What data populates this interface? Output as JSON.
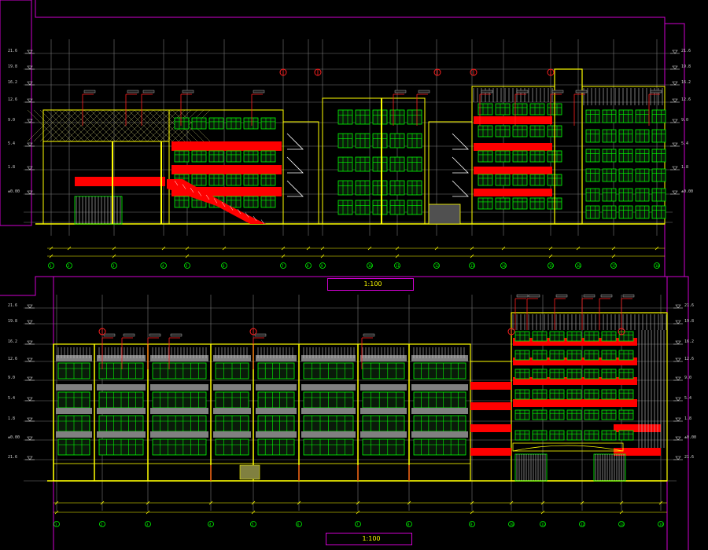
{
  "drawing": {
    "views": [
      {
        "id": "elevation-top",
        "title": "",
        "scale": "1:100",
        "axis_ticks": [
          "1",
          "2",
          "3",
          "4",
          "5",
          "6",
          "7",
          "8",
          "9",
          "10",
          "11",
          "12",
          "13",
          "14",
          "15",
          "16",
          "17",
          "18",
          "19",
          "20",
          "21"
        ],
        "level_marks": [
          "21.6",
          "19.8",
          "16.2",
          "12.6",
          "9.0",
          "5.4",
          "1.8",
          "±0.00"
        ]
      },
      {
        "id": "elevation-bottom",
        "title": "",
        "scale": "1:100",
        "axis_ticks": [
          "1",
          "2",
          "3",
          "4",
          "5",
          "6",
          "7",
          "8",
          "9",
          "10",
          "11",
          "12",
          "13",
          "14",
          "15",
          "16"
        ],
        "level_marks": [
          "21.6",
          "19.8",
          "16.2",
          "12.6",
          "9.0",
          "5.4",
          "1.8",
          "±0.00"
        ]
      }
    ],
    "colors": {
      "background": "#000000",
      "frame": "#d000d0",
      "grid": "#d0d0d0",
      "outline": "#ffff00",
      "window": "#00ff00",
      "balcony": "#ff0000",
      "panel": "#808080",
      "callout": "#ff2020",
      "dim": "#ffff00"
    }
  }
}
